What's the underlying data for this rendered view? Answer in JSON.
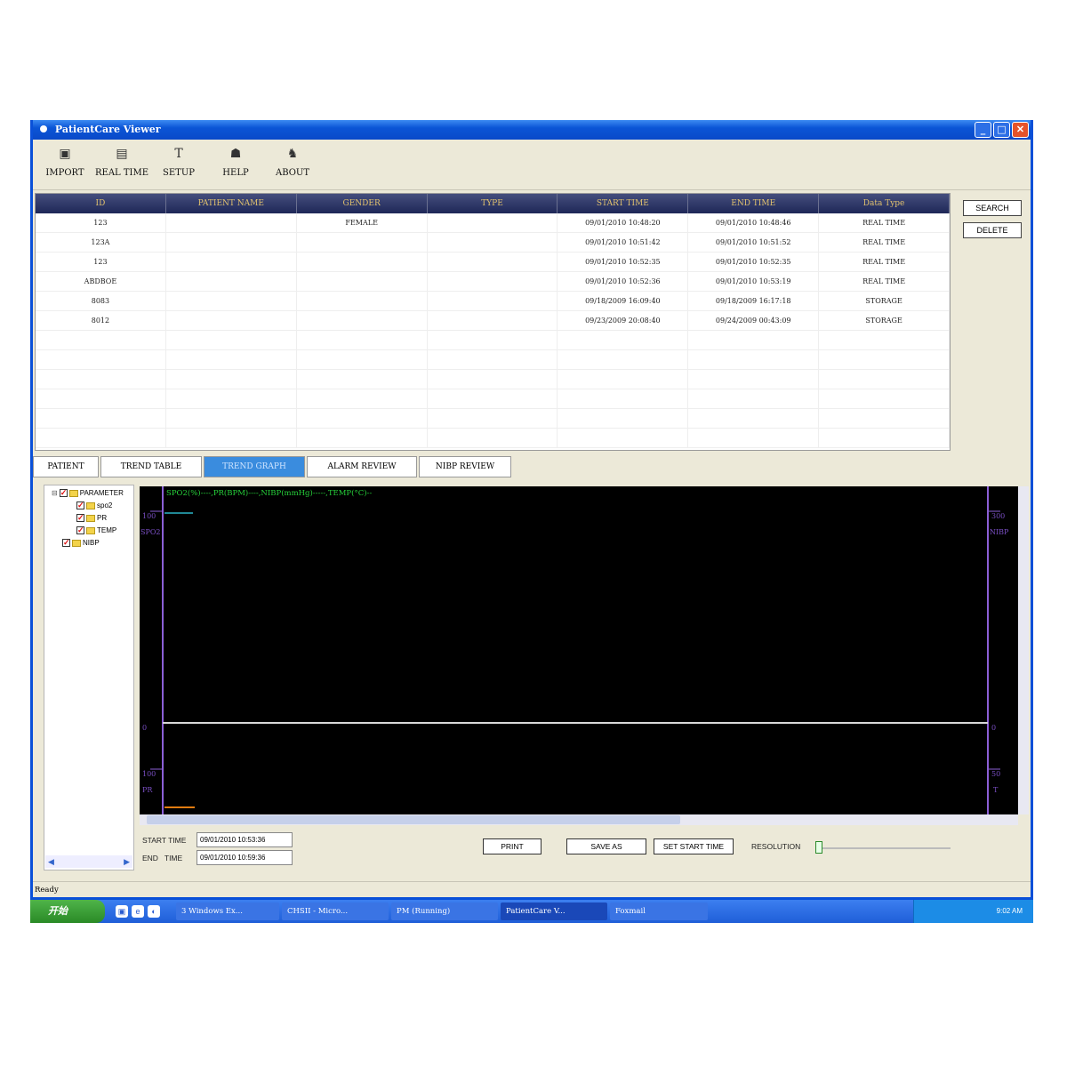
{
  "window": {
    "title": "PatientCare Viewer",
    "controls": [
      "_",
      "□",
      "✕"
    ]
  },
  "toolbar": [
    {
      "label": "IMPORT",
      "icon": "save-icon"
    },
    {
      "label": "REAL TIME",
      "icon": "monitor-icon"
    },
    {
      "label": "SETUP",
      "icon": "tool-icon"
    },
    {
      "label": "HELP",
      "icon": "help-icon"
    },
    {
      "label": "ABOUT",
      "icon": "about-icon"
    }
  ],
  "grid": {
    "headers": [
      "ID",
      "PATIENT NAME",
      "GENDER",
      "TYPE",
      "START TIME",
      "END TIME",
      "Data Type"
    ],
    "rows": [
      [
        "123",
        "",
        "FEMALE",
        "",
        "09/01/2010 10:48:20",
        "09/01/2010 10:48:46",
        "REAL TIME"
      ],
      [
        "123A",
        "",
        "",
        "",
        "09/01/2010 10:51:42",
        "09/01/2010 10:51:52",
        "REAL TIME"
      ],
      [
        "123",
        "",
        "",
        "",
        "09/01/2010 10:52:35",
        "09/01/2010 10:52:35",
        "REAL TIME"
      ],
      [
        "ABDBOE",
        "",
        "",
        "",
        "09/01/2010 10:52:36",
        "09/01/2010 10:53:19",
        "REAL TIME"
      ],
      [
        "8083",
        "",
        "",
        "",
        "09/18/2009 16:09:40",
        "09/18/2009 16:17:18",
        "STORAGE"
      ],
      [
        "8012",
        "",
        "",
        "",
        "09/23/2009 20:08:40",
        "09/24/2009 00:43:09",
        "STORAGE"
      ]
    ]
  },
  "side_buttons": {
    "search": "SEARCH",
    "delete": "DELETE"
  },
  "tabs": [
    {
      "label": "PATIENT",
      "active": false
    },
    {
      "label": "TREND TABLE",
      "active": false
    },
    {
      "label": "TREND GRAPH",
      "active": true
    },
    {
      "label": "ALARM REVIEW",
      "active": false
    },
    {
      "label": "NIBP REVIEW",
      "active": false
    }
  ],
  "tree": {
    "root": "PARAMETER",
    "children": [
      "spo2",
      "PR",
      "TEMP"
    ],
    "extra": "NIBP"
  },
  "graph": {
    "legend": "SPO2(%)----,PR(BPM)----,NIBP(mmHg)-----,TEMP(°C)--",
    "left_labels": [
      "100",
      "SPO2",
      "0",
      "100",
      "PR"
    ],
    "right_labels": [
      "300",
      "NIBP",
      "0",
      "50",
      "T"
    ]
  },
  "controls": {
    "start_label": "START TIME",
    "start_value": "09/01/2010 10:53:36",
    "end_label": "END   TIME",
    "end_value": "09/01/2010 10:59:36",
    "print": "PRINT",
    "save_as": "SAVE AS",
    "set_start": "SET START TIME",
    "resolution": "RESOLUTION"
  },
  "status": "Ready",
  "taskbar": {
    "start": "开始",
    "tasks": [
      "3 Windows Ex...",
      "CHSII - Micro...",
      "PM (Running)",
      "PatientCare V...",
      "Foxmail"
    ],
    "tray_time": "9:02 AM"
  }
}
